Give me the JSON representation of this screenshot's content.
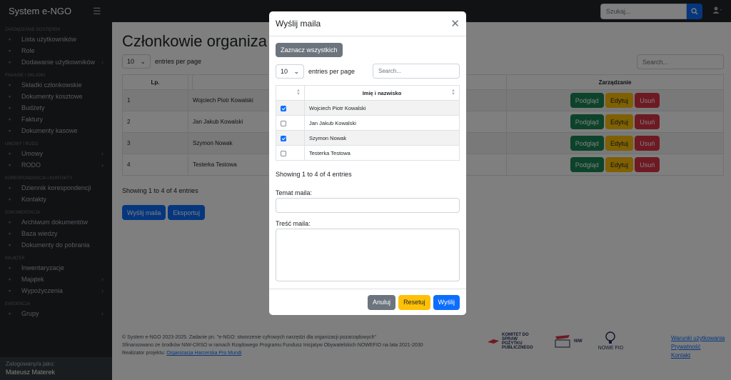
{
  "app": {
    "brand": "System e-NGO",
    "search_placeholder": "Szukaj..."
  },
  "sidebar": {
    "sections": [
      {
        "title": "Zarządzanie dostępem",
        "items": [
          {
            "label": "Lista użytkowników",
            "icon": "users-icon"
          },
          {
            "label": "Role",
            "icon": "roles-icon"
          },
          {
            "label": "Dodawanie użytkowników",
            "icon": "user-plus-icon",
            "chevron": true
          }
        ]
      },
      {
        "title": "Finanse i składki",
        "items": [
          {
            "label": "Składki członkowskie",
            "icon": "money-icon"
          },
          {
            "label": "Dokumenty kosztowe",
            "icon": "invoice-icon"
          },
          {
            "label": "Budżety",
            "icon": "budget-icon"
          },
          {
            "label": "Faktury",
            "icon": "receipt-icon"
          },
          {
            "label": "Dokumenty kasowe",
            "icon": "cash-icon"
          }
        ]
      },
      {
        "title": "Umowy i RODO",
        "items": [
          {
            "label": "Umowy",
            "icon": "contract-icon",
            "chevron": true
          },
          {
            "label": "RODO",
            "icon": "shield-icon",
            "chevron": true
          }
        ]
      },
      {
        "title": "Korespondencja i kontakty",
        "items": [
          {
            "label": "Dziennik korespondencji",
            "icon": "journal-icon"
          },
          {
            "label": "Kontakty",
            "icon": "contacts-icon"
          }
        ]
      },
      {
        "title": "Dokumentacja",
        "items": [
          {
            "label": "Archiwum dokumentów",
            "icon": "archive-icon"
          },
          {
            "label": "Baza wiedzy",
            "icon": "book-icon"
          },
          {
            "label": "Dokumenty do pobrania",
            "icon": "download-icon"
          }
        ]
      },
      {
        "title": "Majątek",
        "items": [
          {
            "label": "Inwentaryzacje",
            "icon": "inventory-icon"
          },
          {
            "label": "Majątek",
            "icon": "assets-icon",
            "chevron": true
          },
          {
            "label": "Wypożyczenia",
            "icon": "loan-icon",
            "chevron": true
          }
        ]
      },
      {
        "title": "Ewidencja",
        "items": [
          {
            "label": "Grupy",
            "icon": "groups-icon",
            "chevron": true
          }
        ]
      }
    ],
    "footer_label": "Zalogowany/a jako:",
    "footer_user": "Mateusz Materek"
  },
  "main": {
    "title": "Członkowie organiza",
    "page_size": "10",
    "entries_label": "entries per page",
    "search_placeholder": "Search...",
    "columns": {
      "lp": "Lp.",
      "manage": "Zarządzanie"
    },
    "rows": [
      {
        "lp": "1",
        "name": "Wojciech Piotr Kowalski"
      },
      {
        "lp": "2",
        "name": "Jan Jakub Kowalski"
      },
      {
        "lp": "3",
        "name": "Szymon Nowak"
      },
      {
        "lp": "4",
        "name": "Testerka Testowa"
      }
    ],
    "row_buttons": {
      "view": "Podgląd",
      "edit": "Edytuj",
      "delete": "Usuń"
    },
    "showing": "Showing 1 to 4 of 4 entries",
    "send_button": "Wyślij maila",
    "export_button": "Eksportuj"
  },
  "footer": {
    "line1": "© System e-NGO 2023-2025. Zadanie pn. \"e-NGO: stworzenie cyfrowych narzędzi dla organizacji pozarządowych\"",
    "line2": "Sfinansowano ze środków NIW-CRSO w ramach Rządowego Programu Fundusz Inicjatyw Obywatelskich NOWEFIO na lata 2021-2030",
    "line3_prefix": "Realizator projektu: ",
    "line3_link": "Organizacja Harcerska Pro Mundi",
    "logo1": "KOMITET DO SPRAW POŻYTKU PUBLICZNEGO",
    "logo2": "NIW",
    "logo3": "NOWE FIO",
    "links": [
      "Warunki użytkowania",
      "Prywatność",
      "Kontakt"
    ]
  },
  "modal": {
    "title": "Wyślij maila",
    "select_all": "Zaznacz wszystkich",
    "page_size": "10",
    "entries_label": "entries per page",
    "search_placeholder": "Search...",
    "col_name": "Imię i nazwisko",
    "rows": [
      {
        "name": "Wojciech Piotr Kowalski",
        "checked": true
      },
      {
        "name": "Jan Jakub Kowalski",
        "checked": false
      },
      {
        "name": "Szymon Nowak",
        "checked": true
      },
      {
        "name": "Testerka Testowa",
        "checked": false
      }
    ],
    "showing": "Showing 1 to 4 of 4 entries",
    "subject_label": "Temat maila:",
    "subject_value": "",
    "body_label": "Treść maila:",
    "body_value": "",
    "cancel": "Anuluj",
    "reset": "Resetuj",
    "send": "Wyślij"
  }
}
